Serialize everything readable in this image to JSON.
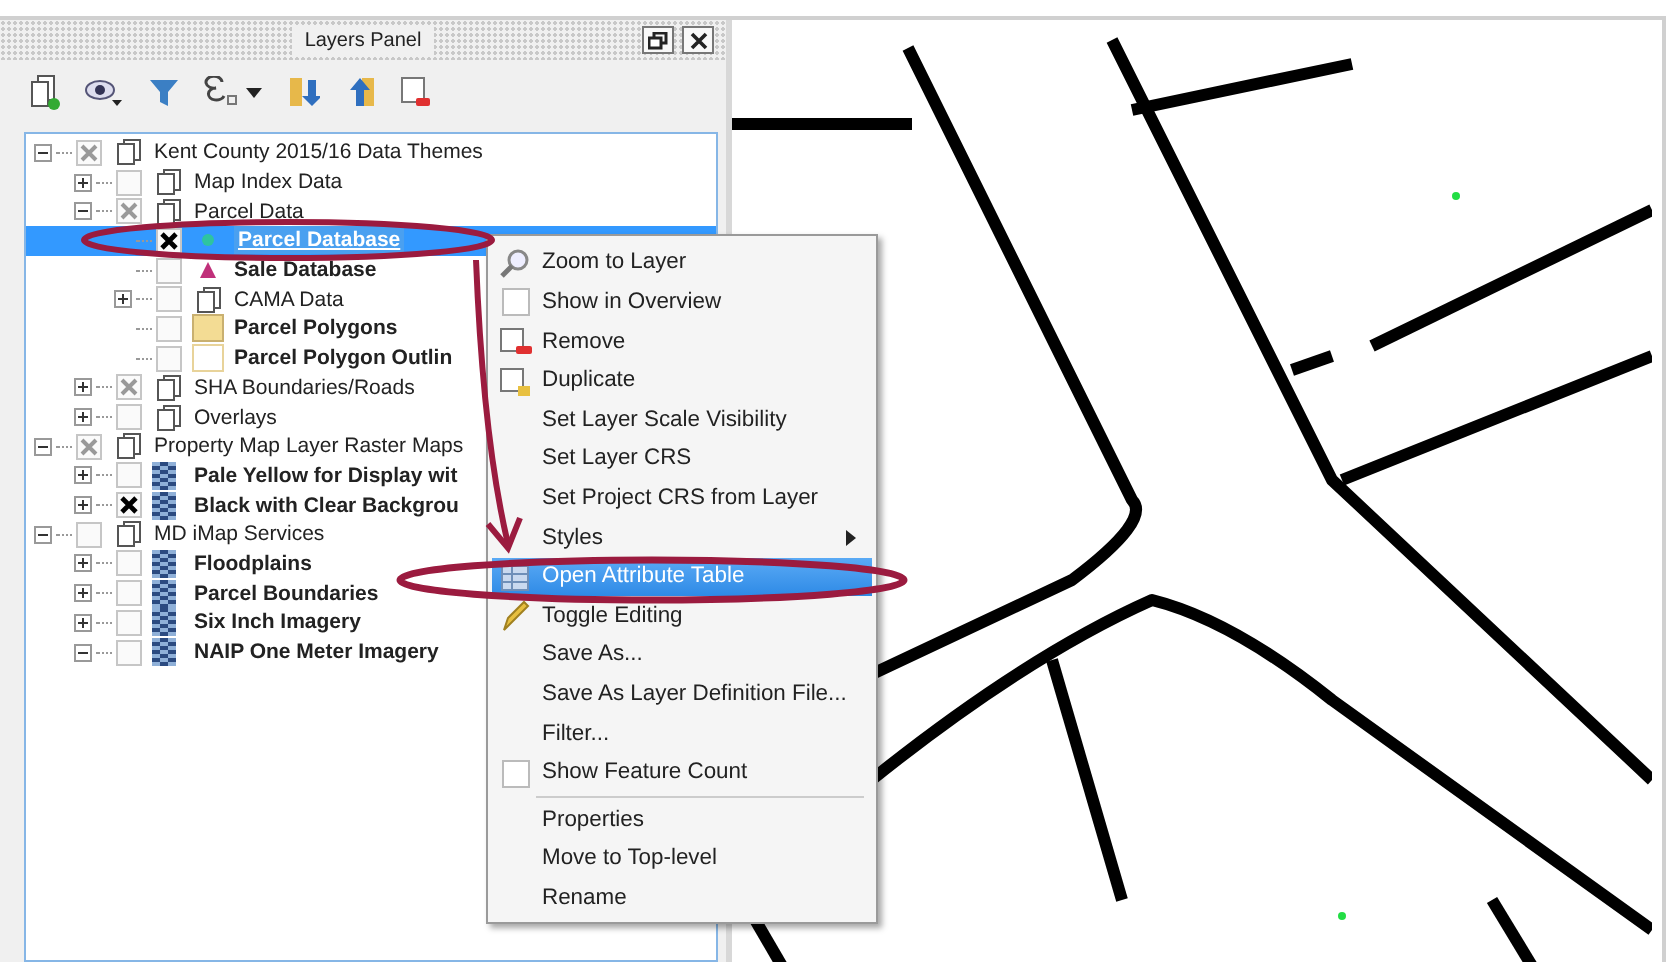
{
  "panel": {
    "title": "Layers Panel"
  },
  "tree": [
    {
      "label": "Kent County 2015/16 Data Themes",
      "kind": "group",
      "checked": false,
      "partial": true,
      "expanded": true,
      "selected": false,
      "children": [
        {
          "label": "Map Index Data",
          "kind": "group",
          "checked": false,
          "partial": false,
          "expanded": false,
          "selected": false
        },
        {
          "label": "Parcel Data",
          "kind": "group",
          "checked": false,
          "partial": true,
          "expanded": true,
          "selected": false,
          "children": [
            {
              "label": "Parcel Database",
              "kind": "point",
              "color": "#2ec4a0",
              "checked": true,
              "selected": true
            },
            {
              "label": "Sale Database",
              "kind": "marker",
              "color": "#c0307a",
              "checked": false,
              "selected": false
            },
            {
              "label": "CAMA Data",
              "kind": "group",
              "checked": false,
              "partial": false,
              "expanded": false,
              "selected": false
            },
            {
              "label": "Parcel Polygons",
              "kind": "fill",
              "color": "#f3dc94",
              "checked": false,
              "selected": false
            },
            {
              "label": "Parcel Polygon Outlin",
              "kind": "outline",
              "color": "#e8d39a",
              "checked": false,
              "selected": false
            }
          ]
        },
        {
          "label": "SHA Boundaries/Roads",
          "kind": "group",
          "checked": false,
          "partial": true,
          "expanded": false,
          "selected": false
        },
        {
          "label": "Overlays",
          "kind": "group",
          "checked": false,
          "partial": false,
          "expanded": false,
          "selected": false
        }
      ]
    },
    {
      "label": "Property Map Layer Raster Maps",
      "kind": "group",
      "checked": false,
      "partial": true,
      "expanded": true,
      "selected": false,
      "children": [
        {
          "label": "Pale Yellow for Display wit",
          "kind": "raster",
          "checked": false,
          "expanded": false,
          "selected": false
        },
        {
          "label": "Black with Clear Backgrou",
          "kind": "raster",
          "checked": true,
          "expanded": false,
          "selected": false
        }
      ]
    },
    {
      "label": "MD iMap Services",
      "kind": "group",
      "checked": false,
      "partial": false,
      "expanded": true,
      "selected": false,
      "children": [
        {
          "label": "Floodplains",
          "kind": "raster",
          "checked": false,
          "expanded": false,
          "selected": false
        },
        {
          "label": "Parcel Boundaries",
          "kind": "raster",
          "checked": false,
          "expanded": false,
          "selected": false
        },
        {
          "label": "Six Inch Imagery",
          "kind": "raster",
          "checked": false,
          "expanded": false,
          "selected": false
        },
        {
          "label": "NAIP One Meter Imagery",
          "kind": "raster",
          "checked": false,
          "expanded": true,
          "selected": false
        }
      ]
    }
  ],
  "context_menu": [
    {
      "label": "Zoom to Layer",
      "kind": "zoom",
      "selected": false
    },
    {
      "label": "Show in Overview",
      "kind": "toggle",
      "checked": false,
      "selected": false
    },
    {
      "label": "Remove",
      "kind": "remove",
      "selected": false
    },
    {
      "label": "Duplicate",
      "kind": "duplicate",
      "selected": false
    },
    {
      "label": "Set Layer Scale Visibility",
      "kind": "plain",
      "selected": false
    },
    {
      "label": "Set Layer CRS",
      "kind": "plain",
      "selected": false
    },
    {
      "label": "Set Project CRS from Layer",
      "kind": "plain",
      "selected": false
    },
    {
      "label": "Styles",
      "kind": "submenu",
      "selected": false
    },
    {
      "label": "Open Attribute Table",
      "kind": "table",
      "selected": true
    },
    {
      "label": "Toggle Editing",
      "kind": "edit",
      "selected": false
    },
    {
      "label": "Save As...",
      "kind": "plain",
      "selected": false
    },
    {
      "label": "Save As Layer Definition File...",
      "kind": "plain",
      "selected": false
    },
    {
      "label": "Filter...",
      "kind": "plain",
      "selected": false
    },
    {
      "label": "Show Feature Count",
      "kind": "toggle",
      "checked": false,
      "selected": false
    },
    {
      "label": "Properties",
      "kind": "plain",
      "separator_before": true,
      "selected": false
    },
    {
      "label": "Move to Top-level",
      "kind": "plain",
      "selected": false
    },
    {
      "label": "Rename",
      "kind": "plain",
      "selected": false
    }
  ]
}
